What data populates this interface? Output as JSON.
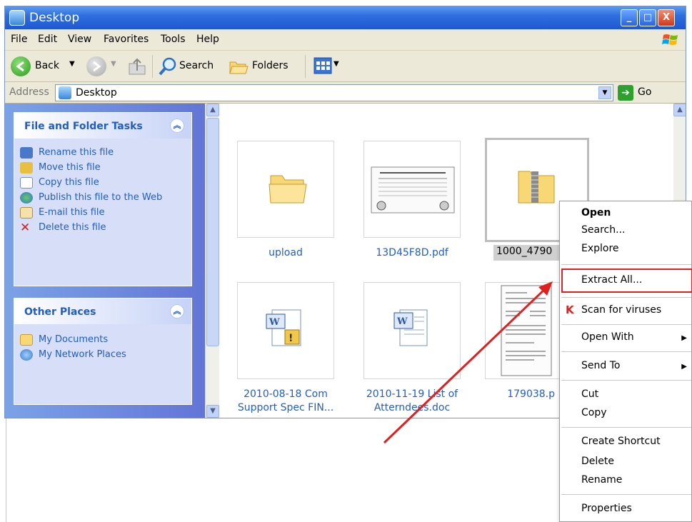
{
  "window": {
    "title": "Desktop",
    "controls": {
      "minimize": "_",
      "maximize": "□",
      "close": "X"
    }
  },
  "menubar": [
    "File",
    "Edit",
    "View",
    "Favorites",
    "Tools",
    "Help"
  ],
  "toolbar": {
    "back_label": "Back",
    "search_label": "Search",
    "folders_label": "Folders"
  },
  "addressbar": {
    "label": "Address",
    "value": "Desktop",
    "go_label": "Go"
  },
  "leftpane": {
    "file_tasks": {
      "title": "File and Folder Tasks",
      "items": [
        {
          "label": "Rename this file",
          "icon": "rename-icon"
        },
        {
          "label": "Move this file",
          "icon": "move-icon"
        },
        {
          "label": "Copy this file",
          "icon": "copy-icon"
        },
        {
          "label": "Publish this file to the Web",
          "icon": "globe-icon"
        },
        {
          "label": "E-mail this file",
          "icon": "email-icon"
        },
        {
          "label": "Delete this file",
          "icon": "delete-x-icon"
        }
      ]
    },
    "other_places": {
      "title": "Other Places",
      "items": [
        {
          "label": "My Documents",
          "icon": "folder-icon"
        },
        {
          "label": "My Network Places",
          "icon": "network-icon"
        }
      ]
    }
  },
  "files": [
    {
      "name": "upload",
      "type": "folder"
    },
    {
      "name": "13D45F8D.pdf",
      "type": "pdf"
    },
    {
      "name": "1000_4790",
      "type": "zip",
      "selected": true
    },
    {
      "name": "2010-08-18 Com Support Spec FIN...",
      "type": "doc"
    },
    {
      "name": "2010-11-19 List of Atterndees.doc",
      "type": "doc"
    },
    {
      "name": "179038.p",
      "type": "document"
    }
  ],
  "context_menu": {
    "open": "Open",
    "search": "Search...",
    "explore": "Explore",
    "extract_all": "Extract All...",
    "scan": "Scan for viruses",
    "open_with": "Open With",
    "send_to": "Send To",
    "cut": "Cut",
    "copy": "Copy",
    "create_shortcut": "Create Shortcut",
    "delete": "Delete",
    "rename": "Rename",
    "properties": "Properties"
  },
  "colors": {
    "titlebar": "#2e6fe0",
    "link": "#215dc6",
    "annotation": "#e02020"
  }
}
